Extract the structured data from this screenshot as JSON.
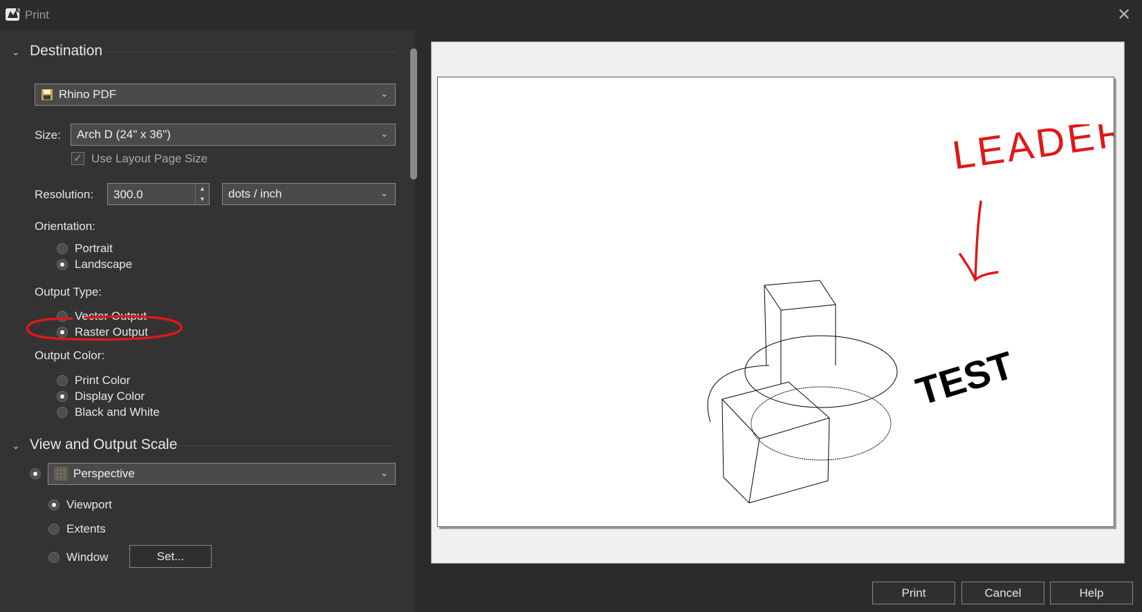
{
  "window": {
    "title": "Print"
  },
  "destination": {
    "section_title": "Destination",
    "printer": "Rhino PDF",
    "size_label": "Size:",
    "size_value": "Arch D (24\" x 36\")",
    "use_layout_page_size": "Use Layout Page Size",
    "resolution_label": "Resolution:",
    "resolution_value": "300.0",
    "resolution_unit": "dots / inch",
    "orientation_label": "Orientation:",
    "orientation_options": [
      "Portrait",
      "Landscape"
    ],
    "orientation_selected": "Landscape",
    "output_type_label": "Output Type:",
    "output_type_options": [
      "Vector Output",
      "Raster Output"
    ],
    "output_type_selected": "Raster Output",
    "output_color_label": "Output Color:",
    "output_color_options": [
      "Print Color",
      "Display Color",
      "Black and White"
    ],
    "output_color_selected": "Display Color"
  },
  "view_scale": {
    "section_title": "View and Output Scale",
    "view": "Perspective",
    "area_options": [
      "Viewport",
      "Extents",
      "Window"
    ],
    "area_selected": "Viewport",
    "set_button": "Set..."
  },
  "preview": {
    "annotation_text": "LEADER",
    "drawing_text": "TEST"
  },
  "footer": {
    "print_button": "Print",
    "cancel_button": "Cancel",
    "help_button": "Help"
  },
  "colors": {
    "annotation": "#e01818",
    "panel": "#333333",
    "titlebar": "#2b2b2b"
  }
}
